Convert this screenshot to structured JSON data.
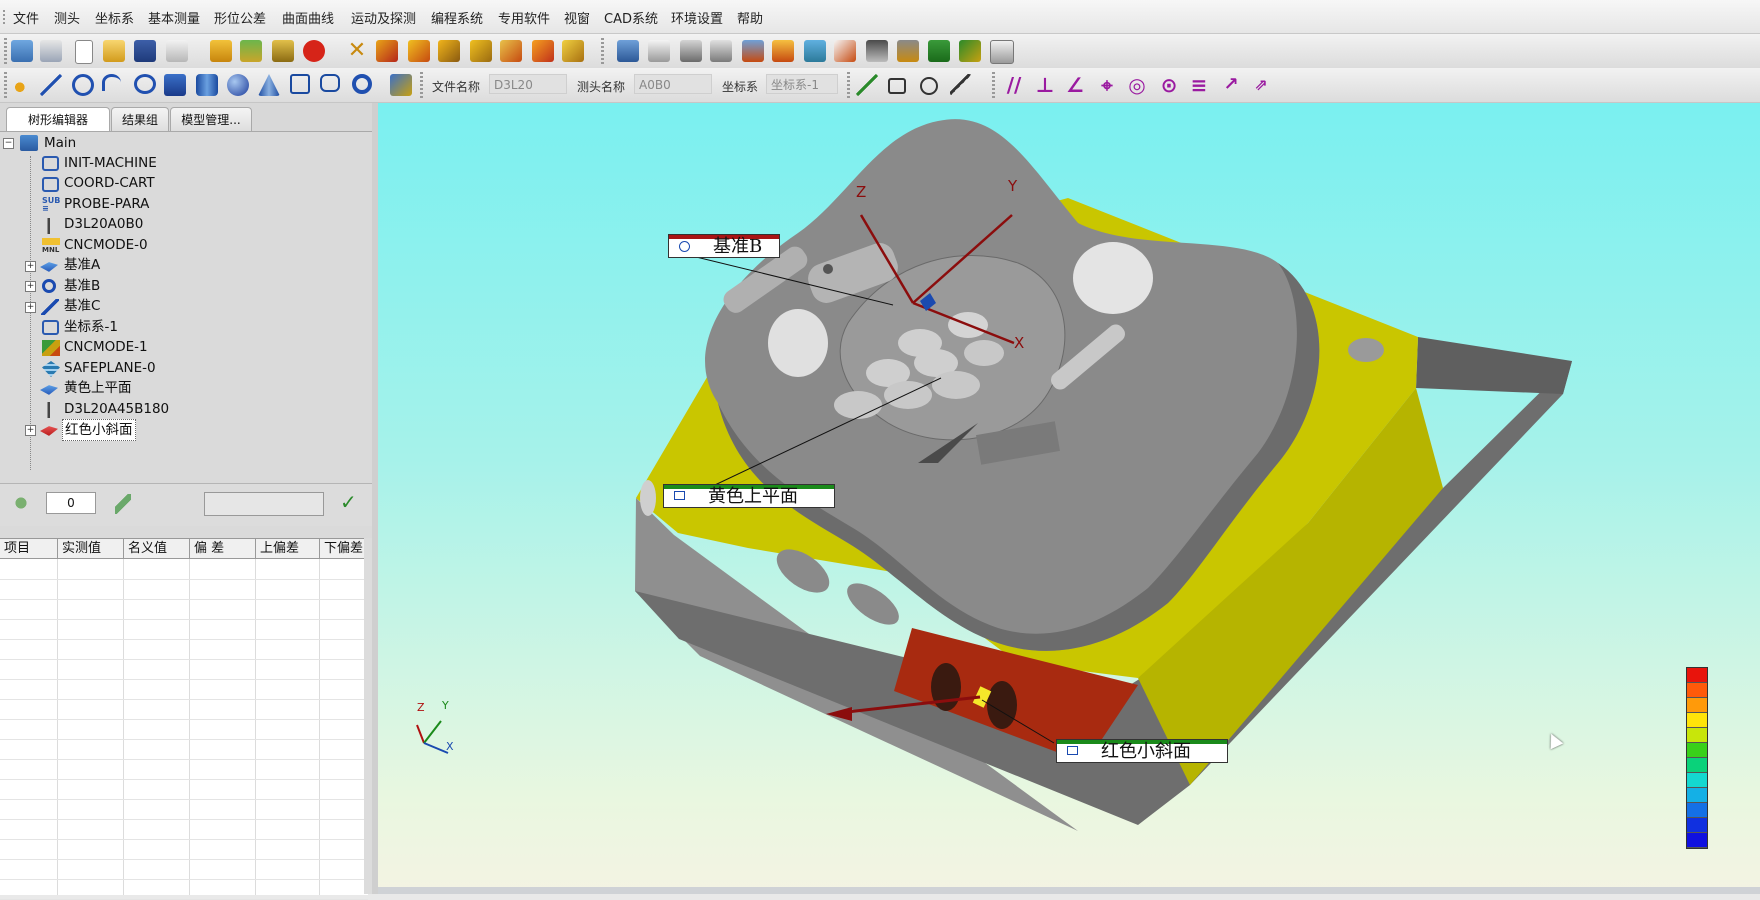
{
  "menu": [
    "文件",
    "测头",
    "坐标系",
    "基本测量",
    "形位公差",
    "曲面曲线",
    "运动及探测",
    "编程系统",
    "专用软件",
    "视窗",
    "CAD系统",
    "环境设置",
    "帮助"
  ],
  "toolbar": {
    "file_name_label": "文件名称",
    "file_name_value": "D3L20",
    "probe_name_label": "测头名称",
    "probe_name_value": "A0B0",
    "coord_label": "坐标系",
    "coord_value": "坐标系-1"
  },
  "tabs": [
    "树形编辑器",
    "结果组",
    "模型管理..."
  ],
  "tree": {
    "root": "Main",
    "items": [
      {
        "label": "INIT-MACHINE",
        "icon": "coordinate-icon",
        "expandable": false
      },
      {
        "label": "COORD-CART",
        "icon": "coordinate-icon",
        "expandable": false
      },
      {
        "label": "PROBE-PARA",
        "icon": "sub-icon",
        "expandable": false
      },
      {
        "label": "D3L20A0B0",
        "icon": "probe-icon",
        "expandable": false
      },
      {
        "label": "CNCMODE-0",
        "icon": "mnl-icon",
        "expandable": false
      },
      {
        "label": "基准A",
        "icon": "plane-icon",
        "expandable": true
      },
      {
        "label": "基准B",
        "icon": "circle-icon",
        "expandable": true
      },
      {
        "label": "基准C",
        "icon": "line-icon",
        "expandable": true
      },
      {
        "label": "坐标系-1",
        "icon": "coordinate-icon",
        "expandable": false
      },
      {
        "label": "CNCMODE-1",
        "icon": "cnc-icon",
        "expandable": false
      },
      {
        "label": "SAFEPLANE-0",
        "icon": "safeplane-icon",
        "expandable": false
      },
      {
        "label": "黄色上平面",
        "icon": "plane-icon",
        "expandable": false
      },
      {
        "label": "D3L20A45B180",
        "icon": "probe-icon",
        "expandable": false
      },
      {
        "label": "红色小斜面",
        "icon": "red-plane-icon",
        "expandable": true
      }
    ]
  },
  "midbar": {
    "count_value": "0",
    "search_value": ""
  },
  "grid": {
    "columns": [
      "项目",
      "实测值",
      "名义值",
      "偏  差",
      "上偏差",
      "下偏差"
    ]
  },
  "viewport": {
    "callouts": [
      "基准B",
      "黄色上平面",
      "红色小斜面"
    ],
    "axes": {
      "x": "X",
      "y": "Y",
      "z": "Z"
    },
    "triad": {
      "x": "X",
      "y": "Y",
      "z": "Z"
    },
    "colors": {
      "part": "#7f7f7f",
      "yellow_face": "#c9c600",
      "red_face": "#a82a10",
      "axis": "#8b0d0d"
    },
    "color_scale": [
      "#e8140c",
      "#ff5a0a",
      "#ff9a0a",
      "#ffe40a",
      "#c8e60a",
      "#39d01a",
      "#0ad27a",
      "#14d8d0",
      "#14b0e6",
      "#1470e6",
      "#1030e0",
      "#1010e0"
    ]
  }
}
